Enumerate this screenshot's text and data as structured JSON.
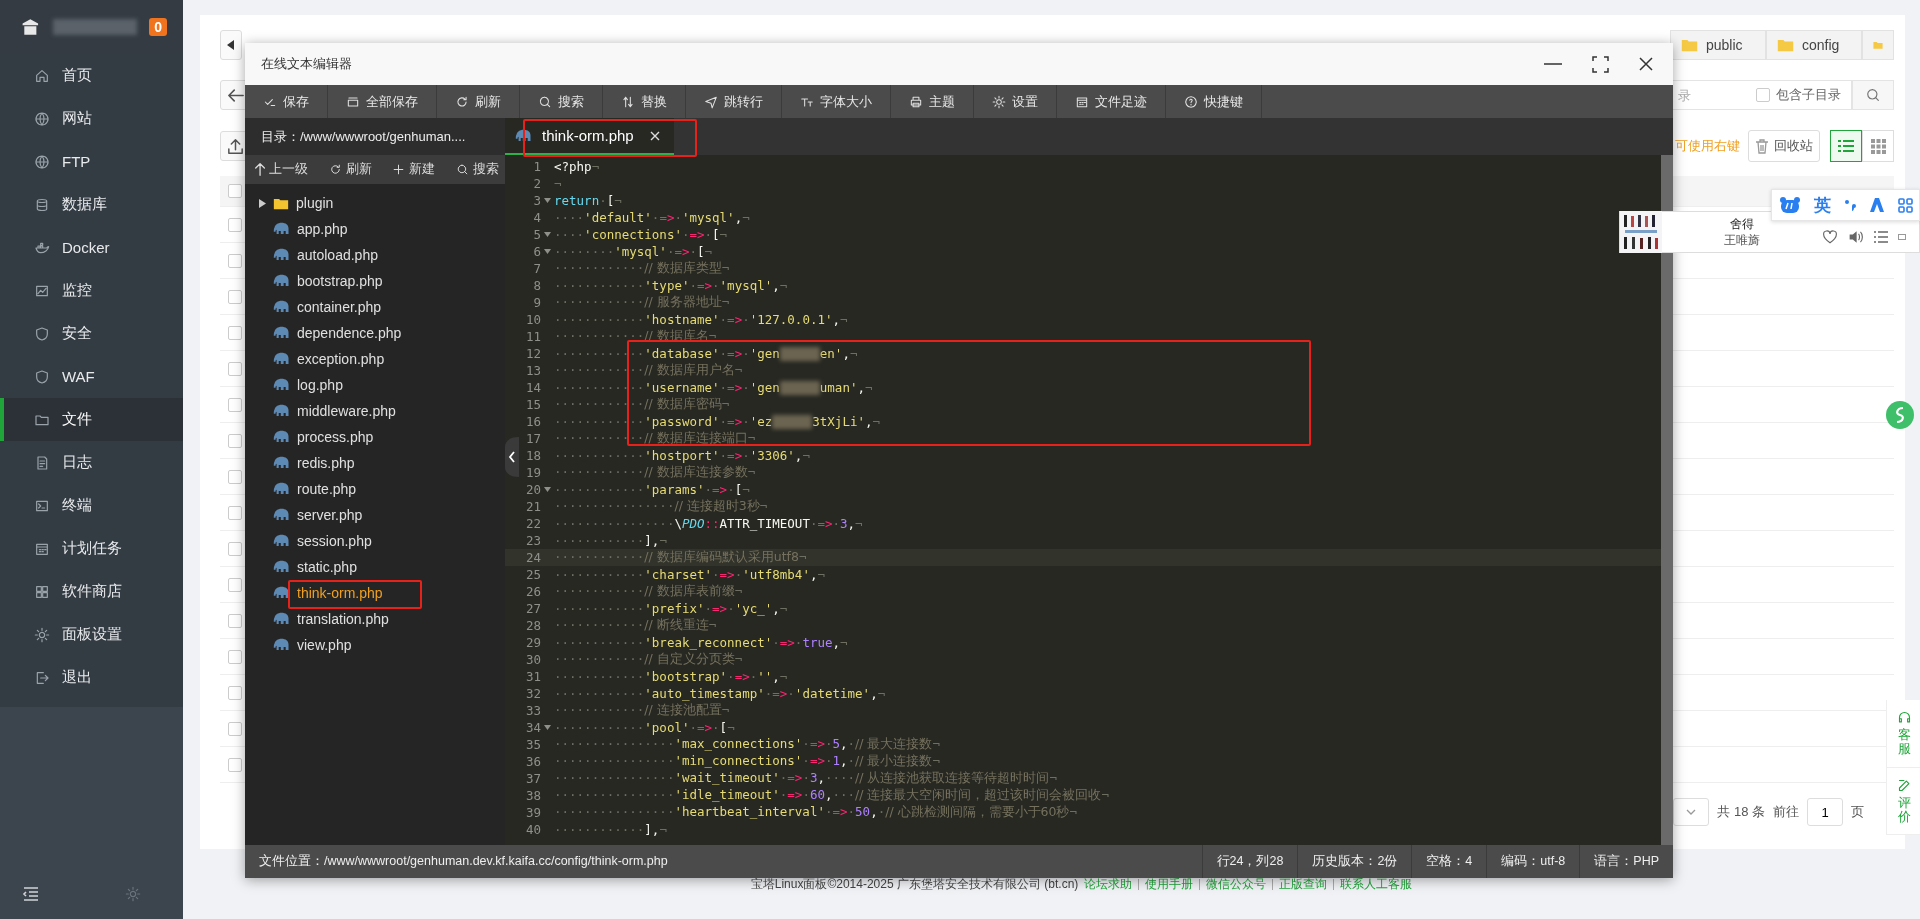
{
  "sidebar": {
    "badge": "0",
    "items": [
      {
        "label": "首页",
        "selected": false
      },
      {
        "label": "网站",
        "selected": false
      },
      {
        "label": "FTP",
        "selected": false
      },
      {
        "label": "数据库",
        "selected": false
      },
      {
        "label": "Docker",
        "selected": false
      },
      {
        "label": "监控",
        "selected": false
      },
      {
        "label": "安全",
        "selected": false
      },
      {
        "label": "WAF",
        "selected": false
      },
      {
        "label": "文件",
        "selected": true
      },
      {
        "label": "日志",
        "selected": false
      },
      {
        "label": "终端",
        "selected": false
      },
      {
        "label": "计划任务",
        "selected": false
      },
      {
        "label": "软件商店",
        "selected": false
      },
      {
        "label": "面板设置",
        "selected": false
      },
      {
        "label": "退出",
        "selected": false
      }
    ]
  },
  "page": {
    "tabs": [
      {
        "label": "public"
      },
      {
        "label": "config"
      }
    ],
    "search": {
      "placeholder": "录"
    },
    "include_subdirs": {
      "label": "包含子目录",
      "checked": false
    },
    "hint": "可使用右键",
    "recycle_button": "回收站",
    "views": [
      {
        "kind": "list",
        "selected": true
      },
      {
        "kind": "grid",
        "selected": false
      }
    ],
    "select_all": {
      "checked": false
    },
    "rows": [
      {
        "checked": false
      },
      {
        "checked": false
      },
      {
        "checked": false
      },
      {
        "checked": false
      },
      {
        "checked": false
      },
      {
        "checked": false
      },
      {
        "checked": false
      },
      {
        "checked": false
      },
      {
        "checked": false
      },
      {
        "checked": false
      },
      {
        "checked": false
      },
      {
        "checked": false
      },
      {
        "checked": false
      },
      {
        "checked": false
      },
      {
        "checked": false
      },
      {
        "checked": false
      }
    ],
    "pagination": {
      "total": "共 18 条",
      "goto": "前往",
      "page": "1",
      "unit": "页"
    }
  },
  "editor": {
    "title": "在线文本编辑器",
    "toolbar": [
      {
        "label": "保存"
      },
      {
        "label": "全部保存"
      },
      {
        "label": "刷新"
      },
      {
        "label": "搜索"
      },
      {
        "label": "替换"
      },
      {
        "label": "跳转行"
      },
      {
        "label": "字体大小"
      },
      {
        "label": "主题"
      },
      {
        "label": "设置"
      },
      {
        "label": "文件足迹"
      },
      {
        "label": "快捷键"
      }
    ],
    "directory": "目录：/www/wwwroot/genhuman....",
    "tree_toolbar": [
      {
        "label": "上一级"
      },
      {
        "label": "刷新"
      },
      {
        "label": "新建"
      },
      {
        "label": "搜索"
      }
    ],
    "files": [
      {
        "name": "plugin",
        "kind": "folder",
        "expanded": false,
        "selected": false
      },
      {
        "name": "app.php",
        "kind": "php",
        "selected": false
      },
      {
        "name": "autoload.php",
        "kind": "php",
        "selected": false
      },
      {
        "name": "bootstrap.php",
        "kind": "php",
        "selected": false
      },
      {
        "name": "container.php",
        "kind": "php",
        "selected": false
      },
      {
        "name": "dependence.php",
        "kind": "php",
        "selected": false
      },
      {
        "name": "exception.php",
        "kind": "php",
        "selected": false
      },
      {
        "name": "log.php",
        "kind": "php",
        "selected": false
      },
      {
        "name": "middleware.php",
        "kind": "php",
        "selected": false
      },
      {
        "name": "process.php",
        "kind": "php",
        "selected": false
      },
      {
        "name": "redis.php",
        "kind": "php",
        "selected": false
      },
      {
        "name": "route.php",
        "kind": "php",
        "selected": false
      },
      {
        "name": "server.php",
        "kind": "php",
        "selected": false
      },
      {
        "name": "session.php",
        "kind": "php",
        "selected": false
      },
      {
        "name": "static.php",
        "kind": "php",
        "selected": false
      },
      {
        "name": "think-orm.php",
        "kind": "php",
        "selected": true
      },
      {
        "name": "translation.php",
        "kind": "php",
        "selected": false
      },
      {
        "name": "view.php",
        "kind": "php",
        "selected": false
      }
    ],
    "tabs": [
      {
        "label": "think-orm.php",
        "selected": true
      }
    ],
    "lines": [
      {
        "n": "1",
        "fold": false,
        "current": false,
        "tokens": [
          {
            "kind": "pl",
            "text": "<?php"
          },
          {
            "kind": "eol",
            "text": "¬"
          }
        ]
      },
      {
        "n": "2",
        "fold": false,
        "current": false,
        "tokens": [
          {
            "kind": "eol",
            "text": "¬"
          }
        ]
      },
      {
        "n": "3",
        "fold": true,
        "current": false,
        "tokens": [
          {
            "kind": "kw",
            "text": "return"
          },
          {
            "kind": "ws",
            "text": "·"
          },
          {
            "kind": "pl",
            "text": "["
          },
          {
            "kind": "eol",
            "text": "¬"
          }
        ]
      },
      {
        "n": "4",
        "fold": false,
        "current": false,
        "tokens": [
          {
            "kind": "ws",
            "text": "····"
          },
          {
            "kind": "str",
            "text": "'default'"
          },
          {
            "kind": "ws",
            "text": "·"
          },
          {
            "kind": "op",
            "text": "=>"
          },
          {
            "kind": "ws",
            "text": "·"
          },
          {
            "kind": "str",
            "text": "'mysql'"
          },
          {
            "kind": "pl",
            "text": ","
          },
          {
            "kind": "eol",
            "text": "¬"
          }
        ]
      },
      {
        "n": "5",
        "fold": true,
        "current": false,
        "tokens": [
          {
            "kind": "ws",
            "text": "····"
          },
          {
            "kind": "str",
            "text": "'connections'"
          },
          {
            "kind": "ws",
            "text": "·"
          },
          {
            "kind": "op",
            "text": "=>"
          },
          {
            "kind": "ws",
            "text": "·"
          },
          {
            "kind": "pl",
            "text": "["
          },
          {
            "kind": "eol",
            "text": "¬"
          }
        ]
      },
      {
        "n": "6",
        "fold": true,
        "current": false,
        "tokens": [
          {
            "kind": "ws",
            "text": "········"
          },
          {
            "kind": "str",
            "text": "'mysql'"
          },
          {
            "kind": "ws",
            "text": "·"
          },
          {
            "kind": "op",
            "text": "=>"
          },
          {
            "kind": "ws",
            "text": "·"
          },
          {
            "kind": "pl",
            "text": "["
          },
          {
            "kind": "eol",
            "text": "¬"
          }
        ]
      },
      {
        "n": "7",
        "fold": false,
        "current": false,
        "tokens": [
          {
            "kind": "ws",
            "text": "············"
          },
          {
            "kind": "cm",
            "text": "// 数据库类型"
          },
          {
            "kind": "eol",
            "text": "¬"
          }
        ]
      },
      {
        "n": "8",
        "fold": false,
        "current": false,
        "tokens": [
          {
            "kind": "ws",
            "text": "············"
          },
          {
            "kind": "str",
            "text": "'type'"
          },
          {
            "kind": "ws",
            "text": "·"
          },
          {
            "kind": "op",
            "text": "=>"
          },
          {
            "kind": "ws",
            "text": "·"
          },
          {
            "kind": "str",
            "text": "'mysql'"
          },
          {
            "kind": "pl",
            "text": ","
          },
          {
            "kind": "eol",
            "text": "¬"
          }
        ]
      },
      {
        "n": "9",
        "fold": false,
        "current": false,
        "tokens": [
          {
            "kind": "ws",
            "text": "············"
          },
          {
            "kind": "cm",
            "text": "// 服务器地址"
          },
          {
            "kind": "eol",
            "text": "¬"
          }
        ]
      },
      {
        "n": "10",
        "fold": false,
        "current": false,
        "tokens": [
          {
            "kind": "ws",
            "text": "············"
          },
          {
            "kind": "str",
            "text": "'hostname'"
          },
          {
            "kind": "ws",
            "text": "·"
          },
          {
            "kind": "op",
            "text": "=>"
          },
          {
            "kind": "ws",
            "text": "·"
          },
          {
            "kind": "str",
            "text": "'127.0.0.1'"
          },
          {
            "kind": "pl",
            "text": ","
          },
          {
            "kind": "eol",
            "text": "¬"
          }
        ]
      },
      {
        "n": "11",
        "fold": false,
        "current": false,
        "tokens": [
          {
            "kind": "ws",
            "text": "············"
          },
          {
            "kind": "cm",
            "text": "// 数据库名"
          },
          {
            "kind": "eol",
            "text": "¬"
          }
        ]
      },
      {
        "n": "12",
        "fold": false,
        "current": false,
        "tokens": [
          {
            "kind": "ws",
            "text": "············"
          },
          {
            "kind": "str",
            "text": "'database'"
          },
          {
            "kind": "ws",
            "text": "·"
          },
          {
            "kind": "op",
            "text": "=>"
          },
          {
            "kind": "ws",
            "text": "·"
          },
          {
            "kind": "str",
            "text": "'gen"
          },
          {
            "kind": "redacted"
          },
          {
            "kind": "str",
            "text": "en'"
          },
          {
            "kind": "pl",
            "text": ","
          },
          {
            "kind": "eol",
            "text": "¬"
          }
        ]
      },
      {
        "n": "13",
        "fold": false,
        "current": false,
        "tokens": [
          {
            "kind": "ws",
            "text": "············"
          },
          {
            "kind": "cm",
            "text": "// 数据库用户名"
          },
          {
            "kind": "eol",
            "text": "¬"
          }
        ]
      },
      {
        "n": "14",
        "fold": false,
        "current": false,
        "tokens": [
          {
            "kind": "ws",
            "text": "············"
          },
          {
            "kind": "str",
            "text": "'username'"
          },
          {
            "kind": "ws",
            "text": "·"
          },
          {
            "kind": "op",
            "text": "=>"
          },
          {
            "kind": "ws",
            "text": "·"
          },
          {
            "kind": "str",
            "text": "'gen"
          },
          {
            "kind": "redacted"
          },
          {
            "kind": "str",
            "text": "uman'"
          },
          {
            "kind": "pl",
            "text": ","
          },
          {
            "kind": "eol",
            "text": "¬"
          }
        ]
      },
      {
        "n": "15",
        "fold": false,
        "current": false,
        "tokens": [
          {
            "kind": "ws",
            "text": "············"
          },
          {
            "kind": "cm",
            "text": "// 数据库密码"
          },
          {
            "kind": "eol",
            "text": "¬"
          }
        ]
      },
      {
        "n": "16",
        "fold": false,
        "current": false,
        "tokens": [
          {
            "kind": "ws",
            "text": "············"
          },
          {
            "kind": "str",
            "text": "'password'"
          },
          {
            "kind": "ws",
            "text": "·"
          },
          {
            "kind": "op",
            "text": "=>"
          },
          {
            "kind": "ws",
            "text": "·"
          },
          {
            "kind": "str",
            "text": "'ez"
          },
          {
            "kind": "redacted"
          },
          {
            "kind": "str",
            "text": "3tXjLi'"
          },
          {
            "kind": "pl",
            "text": ","
          },
          {
            "kind": "eol",
            "text": "¬"
          }
        ]
      },
      {
        "n": "17",
        "fold": false,
        "current": false,
        "tokens": [
          {
            "kind": "ws",
            "text": "············"
          },
          {
            "kind": "cm",
            "text": "// 数据库连接端口"
          },
          {
            "kind": "eol",
            "text": "¬"
          }
        ]
      },
      {
        "n": "18",
        "fold": false,
        "current": false,
        "tokens": [
          {
            "kind": "ws",
            "text": "············"
          },
          {
            "kind": "str",
            "text": "'hostport'"
          },
          {
            "kind": "ws",
            "text": "·"
          },
          {
            "kind": "op",
            "text": "=>"
          },
          {
            "kind": "ws",
            "text": "·"
          },
          {
            "kind": "str",
            "text": "'3306'"
          },
          {
            "kind": "pl",
            "text": ","
          },
          {
            "kind": "eol",
            "text": "¬"
          }
        ]
      },
      {
        "n": "19",
        "fold": false,
        "current": false,
        "tokens": [
          {
            "kind": "ws",
            "text": "············"
          },
          {
            "kind": "cm",
            "text": "// 数据库连接参数"
          },
          {
            "kind": "eol",
            "text": "¬"
          }
        ]
      },
      {
        "n": "20",
        "fold": true,
        "current": false,
        "tokens": [
          {
            "kind": "ws",
            "text": "············"
          },
          {
            "kind": "str",
            "text": "'params'"
          },
          {
            "kind": "ws",
            "text": "·"
          },
          {
            "kind": "op",
            "text": "=>"
          },
          {
            "kind": "ws",
            "text": "·"
          },
          {
            "kind": "pl",
            "text": "["
          },
          {
            "kind": "eol",
            "text": "¬"
          }
        ]
      },
      {
        "n": "21",
        "fold": false,
        "current": false,
        "tokens": [
          {
            "kind": "ws",
            "text": "················"
          },
          {
            "kind": "cm",
            "text": "// 连接超时3秒"
          },
          {
            "kind": "eol",
            "text": "¬"
          }
        ]
      },
      {
        "n": "22",
        "fold": false,
        "current": false,
        "tokens": [
          {
            "kind": "ws",
            "text": "················"
          },
          {
            "kind": "pl",
            "text": "\\"
          },
          {
            "kind": "cls",
            "text": "PDO"
          },
          {
            "kind": "op",
            "text": "::"
          },
          {
            "kind": "pl",
            "text": "ATTR_TIMEOUT"
          },
          {
            "kind": "ws",
            "text": "·"
          },
          {
            "kind": "op",
            "text": "=>"
          },
          {
            "kind": "ws",
            "text": "·"
          },
          {
            "kind": "num",
            "text": "3"
          },
          {
            "kind": "pl",
            "text": ","
          },
          {
            "kind": "eol",
            "text": "¬"
          }
        ]
      },
      {
        "n": "23",
        "fold": false,
        "current": false,
        "tokens": [
          {
            "kind": "ws",
            "text": "············"
          },
          {
            "kind": "pl",
            "text": "],"
          },
          {
            "kind": "eol",
            "text": "¬"
          }
        ]
      },
      {
        "n": "24",
        "fold": false,
        "current": true,
        "tokens": [
          {
            "kind": "ws",
            "text": "············"
          },
          {
            "kind": "cm",
            "text": "// 数据库编码默认采用utf8"
          },
          {
            "kind": "eol",
            "text": "¬"
          }
        ]
      },
      {
        "n": "25",
        "fold": false,
        "current": false,
        "tokens": [
          {
            "kind": "ws",
            "text": "············"
          },
          {
            "kind": "str",
            "text": "'charset'"
          },
          {
            "kind": "ws",
            "text": "·"
          },
          {
            "kind": "op",
            "text": "=>"
          },
          {
            "kind": "ws",
            "text": "·"
          },
          {
            "kind": "str",
            "text": "'utf8mb4'"
          },
          {
            "kind": "pl",
            "text": ","
          },
          {
            "kind": "eol",
            "text": "¬"
          }
        ]
      },
      {
        "n": "26",
        "fold": false,
        "current": false,
        "tokens": [
          {
            "kind": "ws",
            "text": "············"
          },
          {
            "kind": "cm",
            "text": "// 数据库表前缀"
          },
          {
            "kind": "eol",
            "text": "¬"
          }
        ]
      },
      {
        "n": "27",
        "fold": false,
        "current": false,
        "tokens": [
          {
            "kind": "ws",
            "text": "············"
          },
          {
            "kind": "str",
            "text": "'prefix'"
          },
          {
            "kind": "ws",
            "text": "·"
          },
          {
            "kind": "op",
            "text": "=>"
          },
          {
            "kind": "ws",
            "text": "·"
          },
          {
            "kind": "str",
            "text": "'yc_'"
          },
          {
            "kind": "pl",
            "text": ","
          },
          {
            "kind": "eol",
            "text": "¬"
          }
        ]
      },
      {
        "n": "28",
        "fold": false,
        "current": false,
        "tokens": [
          {
            "kind": "ws",
            "text": "············"
          },
          {
            "kind": "cm",
            "text": "// 断线重连"
          },
          {
            "kind": "eol",
            "text": "¬"
          }
        ]
      },
      {
        "n": "29",
        "fold": false,
        "current": false,
        "tokens": [
          {
            "kind": "ws",
            "text": "············"
          },
          {
            "kind": "str",
            "text": "'break_reconnect'"
          },
          {
            "kind": "ws",
            "text": "·"
          },
          {
            "kind": "op",
            "text": "=>"
          },
          {
            "kind": "ws",
            "text": "·"
          },
          {
            "kind": "num",
            "text": "true"
          },
          {
            "kind": "pl",
            "text": ","
          },
          {
            "kind": "eol",
            "text": "¬"
          }
        ]
      },
      {
        "n": "30",
        "fold": false,
        "current": false,
        "tokens": [
          {
            "kind": "ws",
            "text": "············"
          },
          {
            "kind": "cm",
            "text": "// 自定义分页类"
          },
          {
            "kind": "eol",
            "text": "¬"
          }
        ]
      },
      {
        "n": "31",
        "fold": false,
        "current": false,
        "tokens": [
          {
            "kind": "ws",
            "text": "············"
          },
          {
            "kind": "str",
            "text": "'bootstrap'"
          },
          {
            "kind": "ws",
            "text": "·"
          },
          {
            "kind": "op",
            "text": "=>"
          },
          {
            "kind": "ws",
            "text": "·"
          },
          {
            "kind": "str",
            "text": "''"
          },
          {
            "kind": "pl",
            "text": ","
          },
          {
            "kind": "eol",
            "text": "¬"
          }
        ]
      },
      {
        "n": "32",
        "fold": false,
        "current": false,
        "tokens": [
          {
            "kind": "ws",
            "text": "············"
          },
          {
            "kind": "str",
            "text": "'auto_timestamp'"
          },
          {
            "kind": "ws",
            "text": "·"
          },
          {
            "kind": "op",
            "text": "=>"
          },
          {
            "kind": "ws",
            "text": "·"
          },
          {
            "kind": "str",
            "text": "'datetime'"
          },
          {
            "kind": "pl",
            "text": ","
          },
          {
            "kind": "eol",
            "text": "¬"
          }
        ]
      },
      {
        "n": "33",
        "fold": false,
        "current": false,
        "tokens": [
          {
            "kind": "ws",
            "text": "············"
          },
          {
            "kind": "cm",
            "text": "// 连接池配置"
          },
          {
            "kind": "eol",
            "text": "¬"
          }
        ]
      },
      {
        "n": "34",
        "fold": true,
        "current": false,
        "tokens": [
          {
            "kind": "ws",
            "text": "············"
          },
          {
            "kind": "str",
            "text": "'pool'"
          },
          {
            "kind": "ws",
            "text": "·"
          },
          {
            "kind": "op",
            "text": "=>"
          },
          {
            "kind": "ws",
            "text": "·"
          },
          {
            "kind": "pl",
            "text": "["
          },
          {
            "kind": "eol",
            "text": "¬"
          }
        ]
      },
      {
        "n": "35",
        "fold": false,
        "current": false,
        "tokens": [
          {
            "kind": "ws",
            "text": "················"
          },
          {
            "kind": "str",
            "text": "'max_connections'"
          },
          {
            "kind": "ws",
            "text": "·"
          },
          {
            "kind": "op",
            "text": "=>"
          },
          {
            "kind": "ws",
            "text": "·"
          },
          {
            "kind": "num",
            "text": "5"
          },
          {
            "kind": "pl",
            "text": ","
          },
          {
            "kind": "ws",
            "text": "·"
          },
          {
            "kind": "cm",
            "text": "// 最大连接数"
          },
          {
            "kind": "eol",
            "text": "¬"
          }
        ]
      },
      {
        "n": "36",
        "fold": false,
        "current": false,
        "tokens": [
          {
            "kind": "ws",
            "text": "················"
          },
          {
            "kind": "str",
            "text": "'min_connections'"
          },
          {
            "kind": "ws",
            "text": "·"
          },
          {
            "kind": "op",
            "text": "=>"
          },
          {
            "kind": "ws",
            "text": "·"
          },
          {
            "kind": "num",
            "text": "1"
          },
          {
            "kind": "pl",
            "text": ","
          },
          {
            "kind": "ws",
            "text": "·"
          },
          {
            "kind": "cm",
            "text": "// 最小连接数"
          },
          {
            "kind": "eol",
            "text": "¬"
          }
        ]
      },
      {
        "n": "37",
        "fold": false,
        "current": false,
        "tokens": [
          {
            "kind": "ws",
            "text": "················"
          },
          {
            "kind": "str",
            "text": "'wait_timeout'"
          },
          {
            "kind": "ws",
            "text": "·"
          },
          {
            "kind": "op",
            "text": "=>"
          },
          {
            "kind": "ws",
            "text": "·"
          },
          {
            "kind": "num",
            "text": "3"
          },
          {
            "kind": "pl",
            "text": ","
          },
          {
            "kind": "ws",
            "text": "····"
          },
          {
            "kind": "cm",
            "text": "// 从连接池获取连接等待超时时间"
          },
          {
            "kind": "eol",
            "text": "¬"
          }
        ]
      },
      {
        "n": "38",
        "fold": false,
        "current": false,
        "tokens": [
          {
            "kind": "ws",
            "text": "················"
          },
          {
            "kind": "str",
            "text": "'idle_timeout'"
          },
          {
            "kind": "ws",
            "text": "·"
          },
          {
            "kind": "op",
            "text": "=>"
          },
          {
            "kind": "ws",
            "text": "·"
          },
          {
            "kind": "num",
            "text": "60"
          },
          {
            "kind": "pl",
            "text": ","
          },
          {
            "kind": "ws",
            "text": "···"
          },
          {
            "kind": "cm",
            "text": "// 连接最大空闲时间，超过该时间会被回收"
          },
          {
            "kind": "eol",
            "text": "¬"
          }
        ]
      },
      {
        "n": "39",
        "fold": false,
        "current": false,
        "tokens": [
          {
            "kind": "ws",
            "text": "················"
          },
          {
            "kind": "str",
            "text": "'heartbeat_interval'"
          },
          {
            "kind": "ws",
            "text": "·"
          },
          {
            "kind": "op",
            "text": "=>"
          },
          {
            "kind": "ws",
            "text": "·"
          },
          {
            "kind": "num",
            "text": "50"
          },
          {
            "kind": "pl",
            "text": ","
          },
          {
            "kind": "ws",
            "text": "·"
          },
          {
            "kind": "cm",
            "text": "// 心跳检测间隔，需要小于60秒"
          },
          {
            "kind": "eol",
            "text": "¬"
          }
        ]
      },
      {
        "n": "40",
        "fold": false,
        "current": false,
        "tokens": [
          {
            "kind": "ws",
            "text": "············"
          },
          {
            "kind": "pl",
            "text": "],"
          },
          {
            "kind": "eol",
            "text": "¬"
          }
        ]
      }
    ],
    "status": {
      "path": "文件位置：/www/wwwroot/genhuman.dev.kf.kaifa.cc/config/think-orm.php",
      "items": [
        "行24，列28",
        "历史版本：2份",
        "空格：4",
        "编码：utf-8",
        "语言：PHP"
      ]
    }
  },
  "music": {
    "title": "舍得",
    "artist": "王唯旖"
  },
  "ime": {
    "label": "英"
  },
  "side_buttons": [
    {
      "label": "客服"
    },
    {
      "label": "评价"
    }
  ],
  "footer": {
    "text": "宝塔Linux面板©2014-2025 广东堡塔安全技术有限公司 (bt.cn)",
    "links": [
      "论坛求助",
      "使用手册",
      "微信公众号",
      "正版查询",
      "联系人工客服"
    ]
  }
}
